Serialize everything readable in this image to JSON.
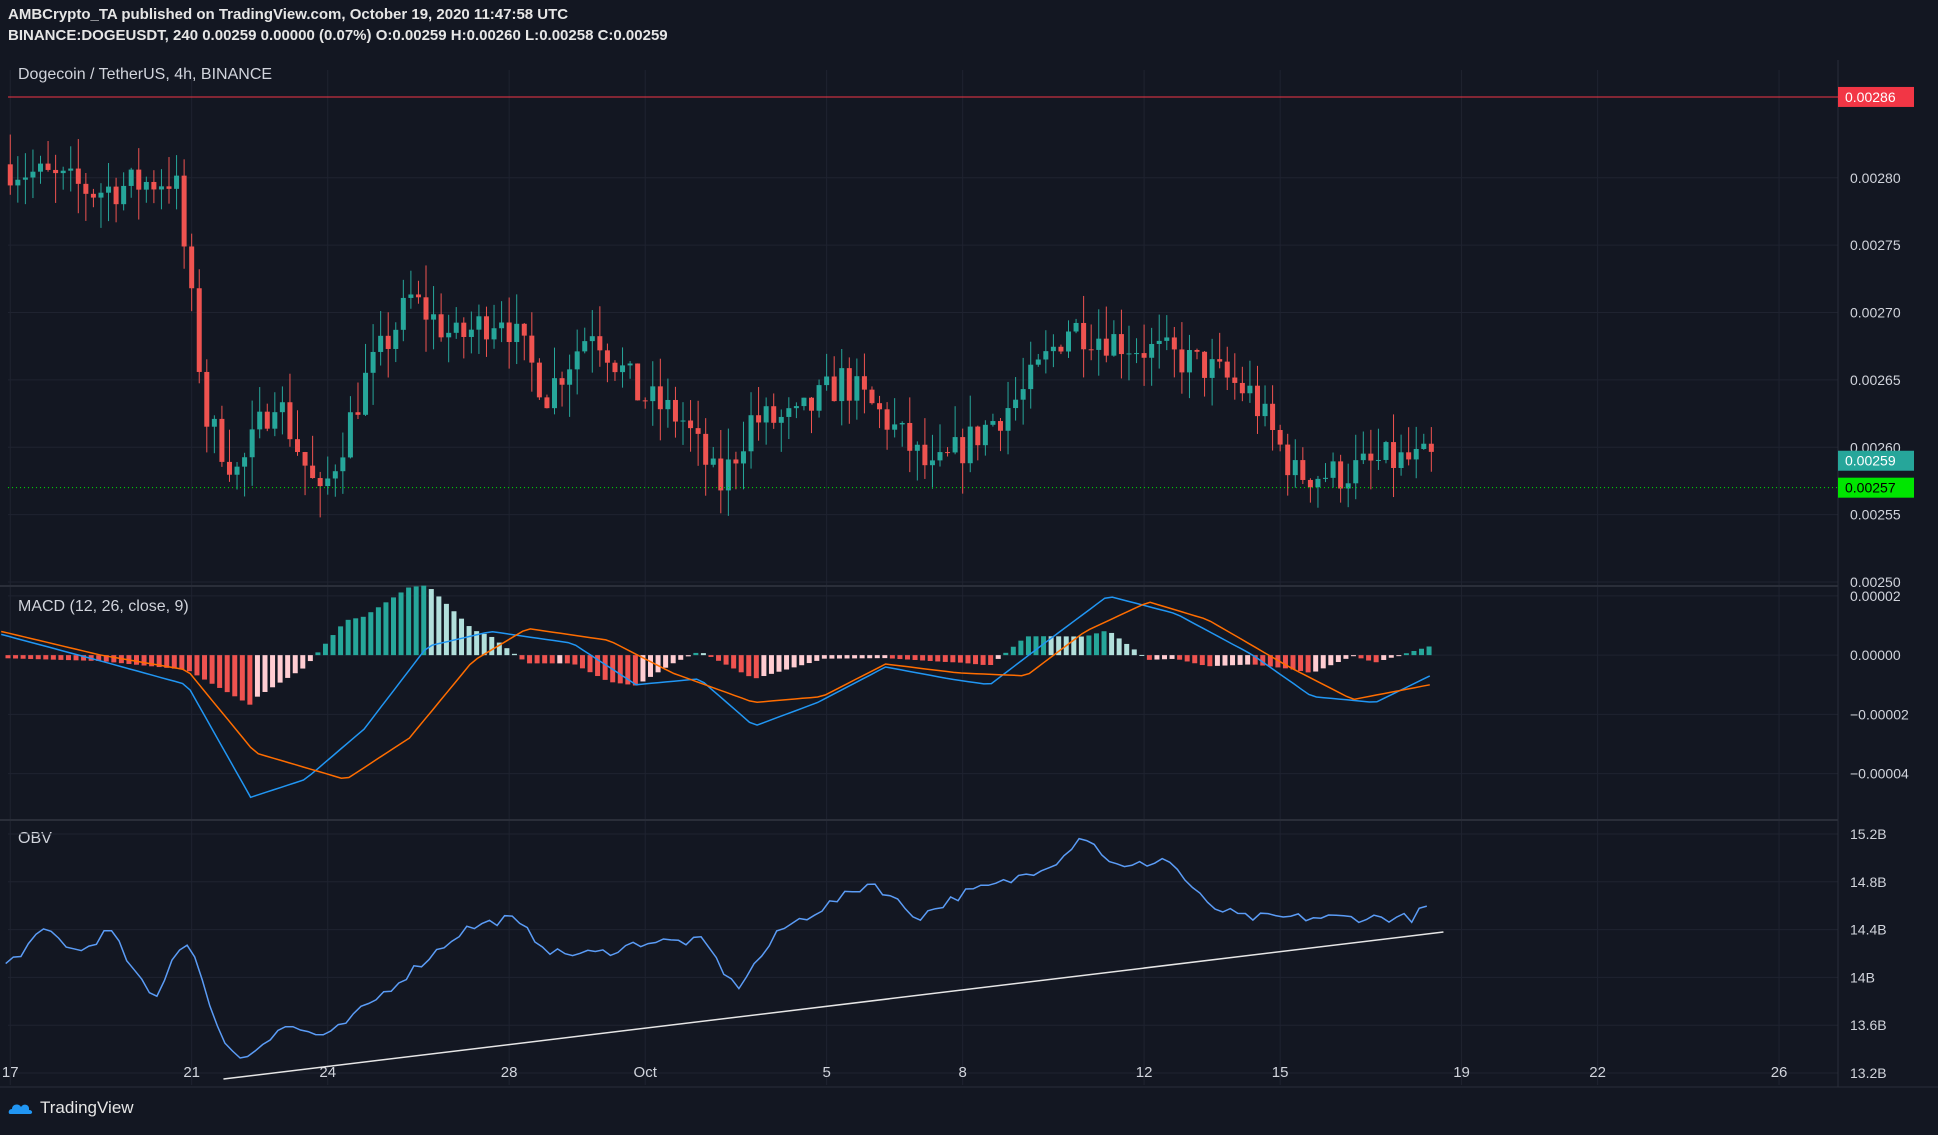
{
  "header": {
    "line1": "AMBCrypto_TA published on TradingView.com, October 19, 2020 11:47:58 UTC",
    "line2_symbol": "BINANCE:DOGEUSDT, 240",
    "line2_change": "0.00259 0.00000 (0.07%)",
    "line2_ohlc": [
      {
        "k": "O:",
        "v": "0.00259"
      },
      {
        "k": "H:",
        "v": "0.00260"
      },
      {
        "k": "L:",
        "v": "0.00258"
      },
      {
        "k": "C:",
        "v": "0.00259"
      }
    ]
  },
  "footer": {
    "brand": "TradingView"
  },
  "chart_data": [
    {
      "type": "candlestick",
      "title": "Dogecoin / TetherUS, 4h, BINANCE",
      "ylim": [
        0.0025,
        0.00288
      ],
      "y_ticks": [
        "0.00280",
        "0.00275",
        "0.00270",
        "0.00265",
        "0.00260",
        "0.00255",
        "0.00250"
      ],
      "y_tick_values": [
        0.0028,
        0.00275,
        0.0027,
        0.00265,
        0.0026,
        0.00255,
        0.0025
      ],
      "resistance_level": {
        "value": 0.00286,
        "label": "0.00286",
        "color": "#f23645"
      },
      "last_price": {
        "value": 0.00259,
        "label": "0.00259",
        "color": "#26a69a"
      },
      "support_level": {
        "value": 0.00257,
        "label": "0.00257",
        "color": "#00e600"
      },
      "anchors": [
        {
          "day": 17,
          "price": 0.00281
        },
        {
          "day": 19,
          "price": 0.00279
        },
        {
          "day": 20.8,
          "price": 0.0028
        },
        {
          "day": 21.5,
          "price": 0.00262
        },
        {
          "day": 22.2,
          "price": 0.00258
        },
        {
          "day": 23,
          "price": 0.00264
        },
        {
          "day": 24,
          "price": 0.00256
        },
        {
          "day": 25,
          "price": 0.00265
        },
        {
          "day": 26,
          "price": 0.00271
        },
        {
          "day": 27,
          "price": 0.00268
        },
        {
          "day": 28,
          "price": 0.0027
        },
        {
          "day": 29,
          "price": 0.00264
        },
        {
          "day": 30,
          "price": 0.00269
        },
        {
          "day": 31,
          "price": 0.00264
        },
        {
          "day": 32,
          "price": 0.00262
        },
        {
          "day": 32.8,
          "price": 0.00257
        },
        {
          "day": 33.5,
          "price": 0.00262
        },
        {
          "day": 34.5,
          "price": 0.00262
        },
        {
          "day": 35.5,
          "price": 0.00265
        },
        {
          "day": 36.5,
          "price": 0.00262
        },
        {
          "day": 37.5,
          "price": 0.00258
        },
        {
          "day": 38.5,
          "price": 0.00261
        },
        {
          "day": 39.5,
          "price": 0.00264
        },
        {
          "day": 40.5,
          "price": 0.00269
        },
        {
          "day": 41.5,
          "price": 0.00268
        },
        {
          "day": 42.5,
          "price": 0.00267
        },
        {
          "day": 43.5,
          "price": 0.00266
        },
        {
          "day": 44.5,
          "price": 0.00264
        },
        {
          "day": 45.5,
          "price": 0.00258
        },
        {
          "day": 46.5,
          "price": 0.00258
        },
        {
          "day": 47.5,
          "price": 0.00259
        },
        {
          "day": 48.3,
          "price": 0.00259
        }
      ]
    },
    {
      "type": "line",
      "title": "MACD (12, 26, close, 9)",
      "ylim": [
        -5.5e-05,
        2.2e-05
      ],
      "y_ticks": [
        "0.00002",
        "0.00000",
        "−0.00002",
        "−0.00004"
      ],
      "y_tick_values": [
        2e-05,
        0.0,
        -2e-05,
        -4e-05
      ],
      "series": [
        {
          "role": "macd",
          "color": "#2196f3",
          "anchors": [
            [
              16.8,
              7e-06
            ],
            [
              19,
              -2e-06
            ],
            [
              20.9,
              -1e-05
            ],
            [
              22.3,
              -4.8e-05
            ],
            [
              23.5,
              -4.2e-05
            ],
            [
              24.8,
              -2.5e-05
            ],
            [
              26.2,
              3e-06
            ],
            [
              27.6,
              8e-06
            ],
            [
              29.4,
              4e-06
            ],
            [
              30.8,
              -1e-05
            ],
            [
              32.2,
              -8e-06
            ],
            [
              33.4,
              -2.4e-05
            ],
            [
              34.8,
              -1.6e-05
            ],
            [
              36.3,
              -4e-06
            ],
            [
              37.7,
              -8e-06
            ],
            [
              38.6,
              -1e-05
            ],
            [
              39.8,
              4e-06
            ],
            [
              41.2,
              2e-05
            ],
            [
              42.7,
              1.4e-05
            ],
            [
              44.4,
              0.0
            ],
            [
              45.7,
              -1.4e-05
            ],
            [
              47.1,
              -1.6e-05
            ],
            [
              48.3,
              -7e-06
            ]
          ]
        },
        {
          "role": "signal",
          "color": "#ff6d00",
          "anchors": [
            [
              16.8,
              8e-06
            ],
            [
              19,
              0.0
            ],
            [
              20.9,
              -5e-06
            ],
            [
              22.4,
              -3.3e-05
            ],
            [
              24.4,
              -4.2e-05
            ],
            [
              25.8,
              -2.8e-05
            ],
            [
              27.2,
              -2e-06
            ],
            [
              28.4,
              9e-06
            ],
            [
              30.2,
              5e-06
            ],
            [
              31.6,
              -6e-06
            ],
            [
              33.4,
              -1.6e-05
            ],
            [
              34.9,
              -1.4e-05
            ],
            [
              36.3,
              -3e-06
            ],
            [
              37.9,
              -6e-06
            ],
            [
              39.4,
              -7e-06
            ],
            [
              40.7,
              8e-06
            ],
            [
              42.1,
              1.8e-05
            ],
            [
              43.4,
              1.2e-05
            ],
            [
              45.2,
              -4e-06
            ],
            [
              46.6,
              -1.5e-05
            ],
            [
              48.3,
              -1e-05
            ]
          ]
        }
      ]
    },
    {
      "type": "line",
      "title": "OBV",
      "ylim": [
        13.1,
        15.3
      ],
      "y_ticks": [
        "15.2B",
        "14.8B",
        "14.4B",
        "14B",
        "13.6B",
        "13.2B"
      ],
      "y_tick_values": [
        15.2,
        14.8,
        14.4,
        14.0,
        13.6,
        13.2
      ],
      "series": [
        {
          "role": "obv",
          "color": "#5b9cf6",
          "anchors": [
            [
              16.9,
              14.1
            ],
            [
              17.8,
              14.4
            ],
            [
              18.5,
              14.2
            ],
            [
              19.2,
              14.4
            ],
            [
              19.8,
              14.0
            ],
            [
              20.2,
              13.8
            ],
            [
              20.6,
              14.2
            ],
            [
              21,
              14.3
            ],
            [
              21.5,
              13.6
            ],
            [
              22.1,
              13.3
            ],
            [
              23,
              13.6
            ],
            [
              24,
              13.5
            ],
            [
              25,
              13.8
            ],
            [
              26,
              14.1
            ],
            [
              27,
              14.4
            ],
            [
              28,
              14.5
            ],
            [
              29,
              14.2
            ],
            [
              30,
              14.2
            ],
            [
              31,
              14.3
            ],
            [
              32.3,
              14.3
            ],
            [
              33,
              13.9
            ],
            [
              34,
              14.4
            ],
            [
              35,
              14.6
            ],
            [
              36,
              14.8
            ],
            [
              37,
              14.5
            ],
            [
              38,
              14.7
            ],
            [
              39,
              14.8
            ],
            [
              40.2,
              15.0
            ],
            [
              40.6,
              15.2
            ],
            [
              41.5,
              14.9
            ],
            [
              42.5,
              15.0
            ],
            [
              43.4,
              14.6
            ],
            [
              44.2,
              14.5
            ],
            [
              45,
              14.5
            ],
            [
              46,
              14.5
            ],
            [
              47,
              14.5
            ],
            [
              47.9,
              14.5
            ],
            [
              48.3,
              14.6
            ]
          ]
        },
        {
          "role": "trendline",
          "color": "#e6e6e6",
          "anchors": [
            [
              21.7,
              13.15
            ],
            [
              48.6,
              14.38
            ]
          ]
        }
      ]
    }
  ],
  "x_axis": {
    "ticks": [
      {
        "label": "17",
        "day": 17
      },
      {
        "label": "21",
        "day": 21
      },
      {
        "label": "24",
        "day": 24
      },
      {
        "label": "28",
        "day": 28
      },
      {
        "label": "Oct",
        "day": 31
      },
      {
        "label": "5",
        "day": 35
      },
      {
        "label": "8",
        "day": 38
      },
      {
        "label": "12",
        "day": 42
      },
      {
        "label": "15",
        "day": 45
      },
      {
        "label": "19",
        "day": 49
      },
      {
        "label": "22",
        "day": 52
      },
      {
        "label": "26",
        "day": 56
      }
    ]
  },
  "colors": {
    "up": "#26a69a",
    "down": "#ef5350",
    "hist_up_strong": "#26a69a",
    "hist_up_weak": "#b2dfdb",
    "hist_down_strong": "#ef5350",
    "hist_down_weak": "#ffcdd2",
    "grid": "#1f2330",
    "text": "#d1d4dc"
  }
}
